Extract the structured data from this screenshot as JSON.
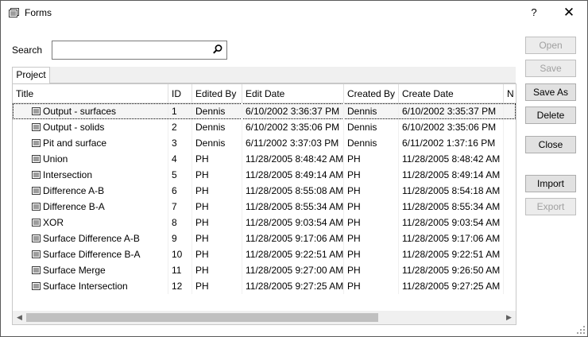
{
  "window": {
    "title": "Forms",
    "help_label": "?",
    "close_label": "✕"
  },
  "search": {
    "label": "Search",
    "value": "",
    "placeholder": ""
  },
  "tabs": [
    {
      "label": "Project",
      "active": true
    }
  ],
  "columns": [
    "Title",
    "ID",
    "Edited By",
    "Edit Date",
    "Created By",
    "Create Date",
    "N"
  ],
  "rows": [
    {
      "title": "Output - surfaces",
      "id": "1",
      "edited_by": "Dennis",
      "edit_date": "6/10/2002 3:36:37 PM",
      "created_by": "Dennis",
      "create_date": "6/10/2002 3:35:37 PM",
      "selected": true
    },
    {
      "title": "Output - solids",
      "id": "2",
      "edited_by": "Dennis",
      "edit_date": "6/10/2002 3:35:06 PM",
      "created_by": "Dennis",
      "create_date": "6/10/2002 3:35:06 PM"
    },
    {
      "title": "Pit and surface",
      "id": "3",
      "edited_by": "Dennis",
      "edit_date": "6/11/2002 3:37:03 PM",
      "created_by": "Dennis",
      "create_date": "6/11/2002 1:37:16 PM"
    },
    {
      "title": "Union",
      "id": "4",
      "edited_by": "PH",
      "edit_date": "11/28/2005 8:48:42 AM",
      "created_by": "PH",
      "create_date": "11/28/2005 8:48:42 AM"
    },
    {
      "title": "Intersection",
      "id": "5",
      "edited_by": "PH",
      "edit_date": "11/28/2005 8:49:14 AM",
      "created_by": "PH",
      "create_date": "11/28/2005 8:49:14 AM"
    },
    {
      "title": "Difference A-B",
      "id": "6",
      "edited_by": "PH",
      "edit_date": "11/28/2005 8:55:08 AM",
      "created_by": "PH",
      "create_date": "11/28/2005 8:54:18 AM"
    },
    {
      "title": "Difference B-A",
      "id": "7",
      "edited_by": "PH",
      "edit_date": "11/28/2005 8:55:34 AM",
      "created_by": "PH",
      "create_date": "11/28/2005 8:55:34 AM"
    },
    {
      "title": "XOR",
      "id": "8",
      "edited_by": "PH",
      "edit_date": "11/28/2005 9:03:54 AM",
      "created_by": "PH",
      "create_date": "11/28/2005 9:03:54 AM"
    },
    {
      "title": "Surface Difference A-B",
      "id": "9",
      "edited_by": "PH",
      "edit_date": "11/28/2005 9:17:06 AM",
      "created_by": "PH",
      "create_date": "11/28/2005 9:17:06 AM"
    },
    {
      "title": "Surface Difference B-A",
      "id": "10",
      "edited_by": "PH",
      "edit_date": "11/28/2005 9:22:51 AM",
      "created_by": "PH",
      "create_date": "11/28/2005 9:22:51 AM"
    },
    {
      "title": "Surface Merge",
      "id": "11",
      "edited_by": "PH",
      "edit_date": "11/28/2005 9:27:00 AM",
      "created_by": "PH",
      "create_date": "11/28/2005 9:26:50 AM"
    },
    {
      "title": "Surface Intersection",
      "id": "12",
      "edited_by": "PH",
      "edit_date": "11/28/2005 9:27:25 AM",
      "created_by": "PH",
      "create_date": "11/28/2005 9:27:25 AM"
    }
  ],
  "buttons": {
    "open": {
      "label": "Open",
      "enabled": false
    },
    "save": {
      "label": "Save",
      "enabled": false
    },
    "save_as": {
      "label": "Save As",
      "enabled": true
    },
    "delete": {
      "label": "Delete",
      "enabled": true
    },
    "close": {
      "label": "Close",
      "enabled": true
    },
    "import": {
      "label": "Import",
      "enabled": true
    },
    "export": {
      "label": "Export",
      "enabled": false
    }
  },
  "scrollbar": {
    "left_arrow": "◀",
    "right_arrow": "▶"
  },
  "icons": {
    "app": "forms-icon",
    "search": "search-icon",
    "row": "form-icon"
  }
}
